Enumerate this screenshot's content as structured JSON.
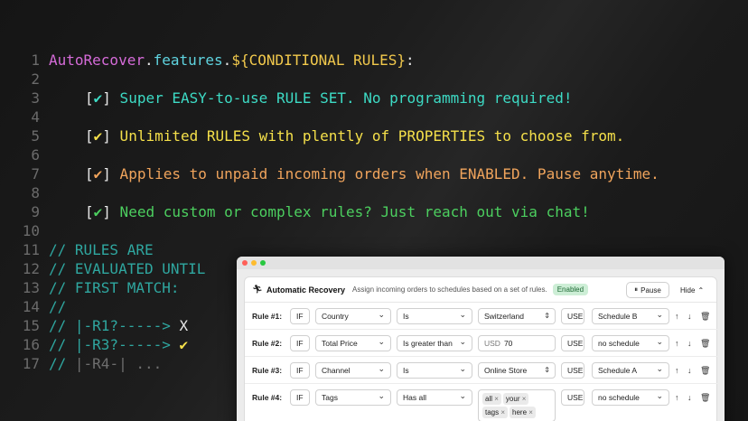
{
  "code": {
    "line_numbers": [
      "1",
      "2",
      "3",
      "4",
      "5",
      "6",
      "7",
      "8",
      "9",
      "10",
      "11",
      "12",
      "13",
      "14",
      "15",
      "16",
      "17"
    ],
    "l1": {
      "obj": "AutoRecover",
      "dot1": ".",
      "prop": "features",
      "dot2": ".",
      "tpl": "${CONDITIONAL RULES}",
      "end": ":"
    },
    "l3": {
      "open": "[",
      "check": "✔",
      "close": "]",
      "text": " Super EASY-to-use RULE SET. No programming required!"
    },
    "l5": {
      "open": "[",
      "check": "✔",
      "close": "]",
      "text": " Unlimited RULES with plently of PROPERTIES to choose from."
    },
    "l7": {
      "open": "[",
      "check": "✔",
      "close": "]",
      "text": " Applies to unpaid incoming orders when ENABLED. Pause anytime."
    },
    "l9": {
      "open": "[",
      "check": "✔",
      "close": "]",
      "text": " Need custom or complex rules? Just reach out via chat!"
    },
    "l11": "// RULES ARE",
    "l12": "// EVALUATED UNTIL",
    "l13": "// FIRST MATCH:",
    "l14": "//",
    "l15": {
      "text": "// |-R1?-----> ",
      "mark": "X"
    },
    "l16": {
      "text": "// |-R3?-----> ",
      "mark": "✔"
    },
    "l17": {
      "text": "// ",
      "dim": "|-R4-| ..."
    }
  },
  "app": {
    "title": "Automatic Recovery",
    "subtitle": "Assign incoming orders to schedules based on a set of rules.",
    "status": "Enabled",
    "pause_label": "Pause",
    "hide_label": "Hide",
    "rules": [
      {
        "label": "Rule #1:",
        "if": "IF",
        "property": "Country",
        "operator": "Is",
        "value": "Switzerland",
        "use": "USE",
        "schedule": "Schedule B"
      },
      {
        "label": "Rule #2:",
        "if": "IF",
        "property": "Total Price",
        "operator": "Is greater than",
        "value_prefix": "USD",
        "value": "70",
        "use": "USE",
        "schedule": "no schedule"
      },
      {
        "label": "Rule #3:",
        "if": "IF",
        "property": "Channel",
        "operator": "Is",
        "value": "Online Store",
        "use": "USE",
        "schedule": "Schedule A"
      },
      {
        "label": "Rule #4:",
        "if": "IF",
        "property": "Tags",
        "operator": "Has all",
        "tags": [
          "all",
          "your",
          "tags",
          "here"
        ],
        "use": "USE",
        "schedule": "no schedule"
      }
    ],
    "icons": {
      "recovery": "person-running-icon",
      "pause": "pause-circle-icon",
      "hide": "chevron-up-icon",
      "up": "arrow-up-icon",
      "down": "arrow-down-icon",
      "delete": "trash-icon"
    }
  }
}
